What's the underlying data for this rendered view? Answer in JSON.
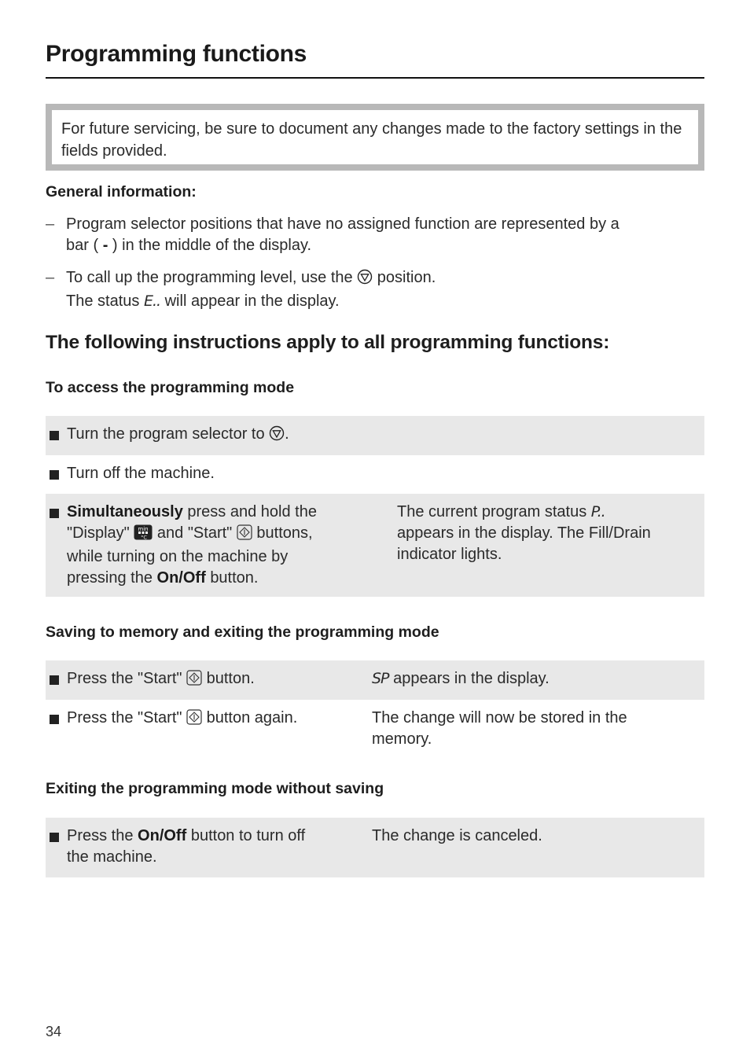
{
  "page": {
    "title": "Programming functions",
    "note": "For future servicing, be sure to document any changes made to the factory settings in the fields provided.",
    "page_number": "34"
  },
  "general": {
    "heading": "General information:",
    "items": [
      {
        "line1": "Program selector positions that have no assigned function are represented by a",
        "line2_pre": "bar (",
        "line2_symbol": "-",
        "line2_post": ") in the middle of the display."
      },
      {
        "line1_pre": "To call up the programming level, use the",
        "line1_icon": "programming-position-icon",
        "line1_post": "position.",
        "line2_pre": "The status",
        "line2_symbol": "E..",
        "line2_post": "will appear in the display."
      }
    ]
  },
  "instructions_heading": "The following instructions apply to all programming functions:",
  "access": {
    "heading": "To access the programming mode",
    "rows": [
      {
        "text_pre": "Turn the program selector to",
        "icon": "programming-position-icon",
        "text_post": "."
      },
      {
        "text": "Turn off the machine."
      },
      {
        "bold_lead": "Simultaneously",
        "line1_rest": "press and hold the",
        "line2_a": "\"Display\"",
        "display_icon": "display-button-icon",
        "display_icon_top": "min",
        "display_icon_bottom": "°C",
        "line2_b": "and \"Start\"",
        "start_icon": "start-button-icon",
        "line2_c": "buttons,",
        "line3": "while turning on the machine by",
        "line4_pre": "pressing the",
        "line4_bold": "On/Off",
        "line4_post": "button.",
        "result_line1_pre": "The current program status",
        "result_symbol": "P..",
        "result_line2": "appears in the display. The Fill/Drain",
        "result_line3": "indicator lights."
      }
    ]
  },
  "saving": {
    "heading": "Saving to memory and exiting the programming mode",
    "rows": [
      {
        "pre": "Press the \"Start\"",
        "icon": "start-button-icon",
        "post": "button.",
        "result_symbol": "SP",
        "result": "appears in the display."
      },
      {
        "pre": "Press the \"Start\"",
        "icon": "start-button-icon",
        "post": "button again.",
        "result_line1": "The change will now be stored in the",
        "result_line2": "memory."
      }
    ]
  },
  "exiting": {
    "heading": "Exiting the programming mode without saving",
    "rows": [
      {
        "pre": "Press the",
        "bold": "On/Off",
        "post": "button to turn off",
        "line2": "the machine.",
        "result": "The change is canceled."
      }
    ]
  }
}
